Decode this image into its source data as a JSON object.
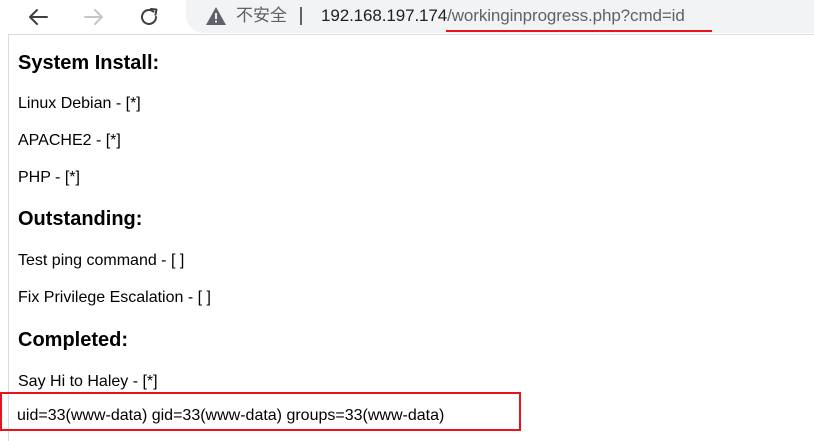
{
  "browser": {
    "security_label": "不安全",
    "url_host": "192.168.197.174",
    "url_path": "/workinginprogress.php?cmd=id",
    "accent_color": "#e8141c"
  },
  "page": {
    "sections": [
      {
        "heading": "System Install:",
        "items": [
          "Linux Debian - [*]",
          "APACHE2 - [*]",
          "PHP - [*]"
        ]
      },
      {
        "heading": "Outstanding:",
        "items": [
          "Test ping command - [ ]",
          "Fix Privilege Escalation - [ ]"
        ]
      },
      {
        "heading": "Completed:",
        "items": [
          "Say Hi to Haley - [*]"
        ]
      }
    ],
    "command_output": "uid=33(www-data) gid=33(www-data) groups=33(www-data)"
  }
}
